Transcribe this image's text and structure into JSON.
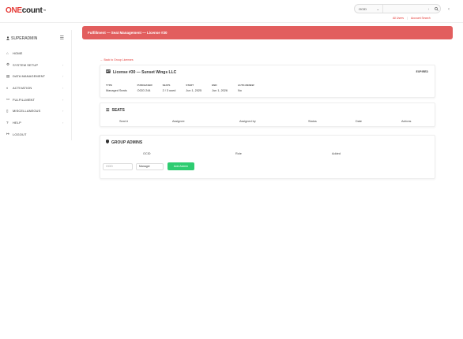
{
  "header": {
    "logo_one": "ONE",
    "logo_count": "count",
    "logo_tm": "™",
    "search": {
      "select_value": "OCID",
      "input_hint": "/",
      "search_icon": "search-icon",
      "select_icon": "chevron-down-icon"
    },
    "collapse_icon": "chevron-left-icon",
    "links": {
      "all_users": "All Users",
      "account_search": "Account Search",
      "sep": "|"
    }
  },
  "sidebar": {
    "user_label": "SUPERADMIN",
    "user_icon": "user-icon",
    "menu_icon": "hamburger-icon",
    "items": [
      {
        "label": "HOME",
        "icon": "home-icon",
        "chevron": false
      },
      {
        "label": "SYSTEM SETUP",
        "icon": "gear-icon",
        "chevron": true
      },
      {
        "label": "DATA MANAGEMENT",
        "icon": "database-icon",
        "chevron": true
      },
      {
        "label": "ACTIVATION",
        "icon": "toggle-icon",
        "chevron": true
      },
      {
        "label": "FULFILLMENT",
        "icon": "credit-card-icon",
        "chevron": true
      },
      {
        "label": "MISCELLANEOUS",
        "icon": "file-icon",
        "chevron": true
      },
      {
        "label": "HELP",
        "icon": "question-icon",
        "chevron": true
      },
      {
        "label": "LOGOUT",
        "icon": "logout-icon",
        "chevron": false
      }
    ]
  },
  "main": {
    "title": "Fulfillment — Seat Management — License #30",
    "back_link": "← Back to Group Licenses",
    "license": {
      "title": "License #30 — Sunset Wings LLC",
      "icon": "id-card-icon",
      "status": "EXPIRED",
      "fields": [
        {
          "label": "TYPE",
          "value": "Managed Seats"
        },
        {
          "label": "PURCHASER",
          "value": "OCID 244"
        },
        {
          "label": "SEATS",
          "value": "2 / 3 used"
        },
        {
          "label": "START",
          "value": "Jun 1, 2025"
        },
        {
          "label": "END",
          "value": "Jun 1, 2026"
        },
        {
          "label": "AUTO-RENEW",
          "value": "No"
        }
      ]
    },
    "seats": {
      "title": "SEATS",
      "icon": "list-icon",
      "columns": [
        "Seat #",
        "Assignee",
        "Assigned by",
        "Status",
        "Date",
        "Actions"
      ]
    },
    "group_admins": {
      "title": "GROUP ADMINS",
      "icon": "shield-icon",
      "columns": [
        "OCID",
        "Role",
        "Added"
      ],
      "ocid_placeholder": "OCID",
      "role_value": "Manager",
      "add_label": "Add Admin"
    }
  }
}
